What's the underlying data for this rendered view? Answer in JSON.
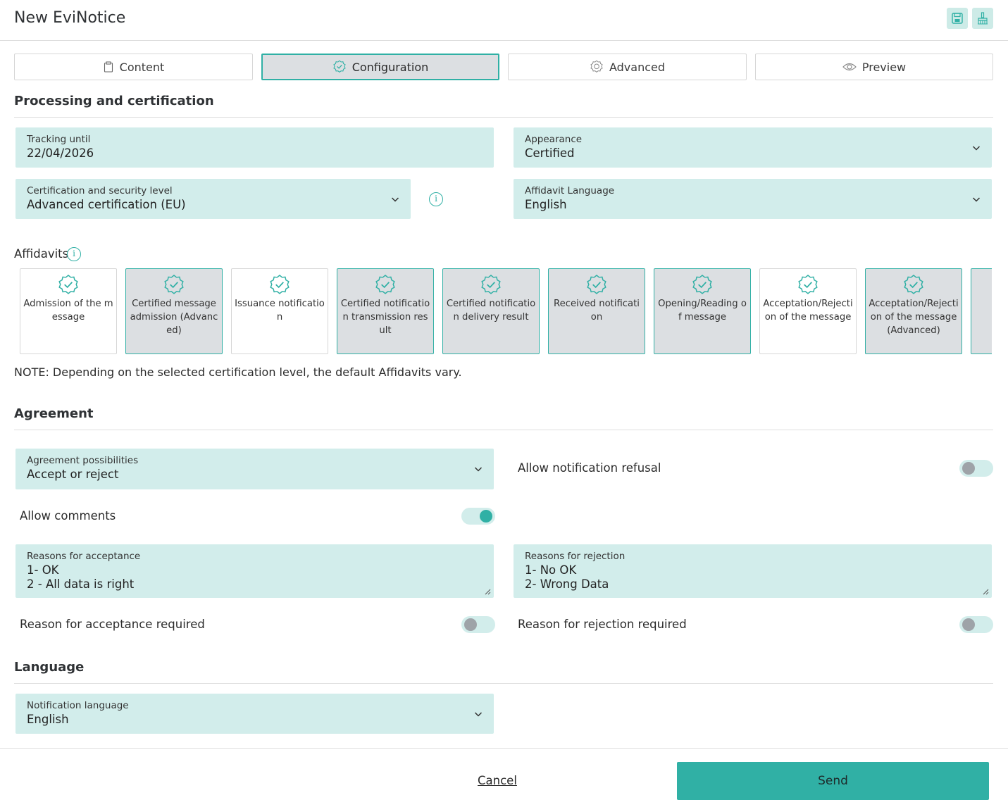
{
  "header": {
    "title": "New EviNotice",
    "save_icon": "save-icon",
    "clear_icon": "broom-icon"
  },
  "tabs": [
    {
      "label": "Content",
      "icon": "clipboard-icon",
      "active": false
    },
    {
      "label": "Configuration",
      "icon": "certified-badge-icon",
      "active": true
    },
    {
      "label": "Advanced",
      "icon": "gear-icon",
      "active": false
    },
    {
      "label": "Preview",
      "icon": "eye-icon",
      "active": false
    }
  ],
  "processing": {
    "title": "Processing and certification",
    "tracking": {
      "label": "Tracking until",
      "value": "22/04/2026"
    },
    "appearance": {
      "label": "Appearance",
      "value": "Certified"
    },
    "certification": {
      "label": "Certification and security level",
      "value": "Advanced certification (EU)"
    },
    "affidavit_language": {
      "label": "Affidavit Language",
      "value": "English"
    }
  },
  "affidavits": {
    "label": "Affidavits",
    "items": [
      {
        "label": "Admission of the message",
        "selected": false
      },
      {
        "label": "Certified message admission (Advanced)",
        "selected": true
      },
      {
        "label": "Issuance notification",
        "selected": false
      },
      {
        "label": "Certified notification transmission result",
        "selected": true
      },
      {
        "label": "Certified notification delivery result",
        "selected": true
      },
      {
        "label": "Received notification",
        "selected": true
      },
      {
        "label": "Opening/Reading of message",
        "selected": true
      },
      {
        "label": "Acceptation/Rejection of the message",
        "selected": false
      },
      {
        "label": "Acceptation/Rejection of the message (Advanced)",
        "selected": true
      },
      {
        "label": "",
        "selected": true
      }
    ],
    "note": "NOTE: Depending on the selected certification level, the default Affidavits vary."
  },
  "agreement": {
    "title": "Agreement",
    "possibilities": {
      "label": "Agreement possibilities",
      "value": "Accept or reject"
    },
    "allow_refusal": {
      "label": "Allow notification refusal",
      "on": false
    },
    "allow_comments": {
      "label": "Allow comments",
      "on": true
    },
    "reasons_acceptance": {
      "label": "Reasons for acceptance",
      "value": "1- OK\n2 - All data is right"
    },
    "reasons_rejection": {
      "label": "Reasons for rejection",
      "value": "1- No OK\n2- Wrong Data"
    },
    "acceptance_required": {
      "label": "Reason for acceptance required",
      "on": false
    },
    "rejection_required": {
      "label": "Reason for rejection required",
      "on": false
    }
  },
  "language": {
    "title": "Language",
    "notification_language": {
      "label": "Notification language",
      "value": "English"
    }
  },
  "footer": {
    "cancel_label": "Cancel",
    "send_label": "Send"
  },
  "colors": {
    "accent": "#30b0a5",
    "field_bg": "#d2edeb",
    "selected_bg": "#dcdfe2"
  }
}
